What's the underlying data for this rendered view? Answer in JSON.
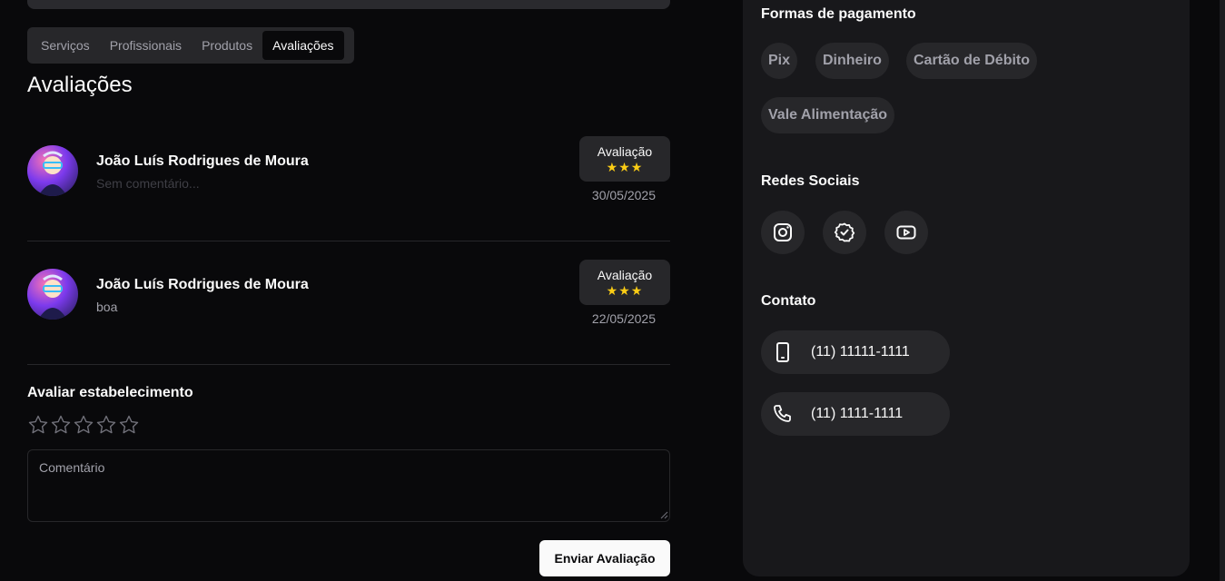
{
  "tabs": [
    {
      "label": "Serviços"
    },
    {
      "label": "Profissionais"
    },
    {
      "label": "Produtos"
    },
    {
      "label": "Avaliações"
    }
  ],
  "active_tab": "Avaliações",
  "reviews_title": "Avaliações",
  "reviews": [
    {
      "name": "João Luís Rodrigues de Moura",
      "comment": "Sem comentário...",
      "rating_label": "Avaliação",
      "stars": "★★★",
      "rating": 3,
      "date": "30/05/2025"
    },
    {
      "name": "João Luís Rodrigues de Moura",
      "comment": "boa",
      "rating_label": "Avaliação",
      "stars": "★★★",
      "rating": 3,
      "date": "22/05/2025"
    }
  ],
  "rate_form": {
    "title": "Avaliar estabelecimento",
    "star_count": 5,
    "selected_rating": 0,
    "comment_placeholder": "Comentário",
    "submit_label": "Enviar Avaliação"
  },
  "sidebar": {
    "payment_title": "Formas de pagamento",
    "payments": [
      {
        "label": "Pix"
      },
      {
        "label": "Dinheiro"
      },
      {
        "label": "Cartão de Débito"
      },
      {
        "label": "Vale Alimentação"
      }
    ],
    "social_title": "Redes Sociais",
    "socials": [
      {
        "icon": "instagram-icon"
      },
      {
        "icon": "verified-badge-icon"
      },
      {
        "icon": "youtube-icon"
      }
    ],
    "contact_title": "Contato",
    "contacts": [
      {
        "icon": "smartphone-icon",
        "value": "(11) 11111-1111"
      },
      {
        "icon": "phone-icon",
        "value": "(11) 1111-1111"
      }
    ]
  },
  "colors": {
    "background": "#09090b",
    "panel": "#18181b",
    "chip": "#27272a",
    "star": "#facc15",
    "muted_text": "#a1a1aa"
  }
}
